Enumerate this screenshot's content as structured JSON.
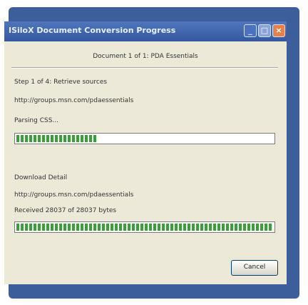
{
  "window": {
    "title": "ISiloX Document Conversion Progress",
    "buttons": {
      "minimize": "_",
      "maximize": "□",
      "close": "×"
    }
  },
  "document": {
    "header": "Document 1 of 1: PDA Essentials"
  },
  "step": {
    "label": "Step 1 of 4: Retrieve sources",
    "url": "http://groups.msn.com/pdaessentials",
    "status": "Parsing CSS...",
    "progress": 0.32
  },
  "download": {
    "label": "Download Detail",
    "url": "http://groups.msn.com/pdaessentials",
    "received": "Received 28037 of 28037 bytes",
    "progress": 1.0
  },
  "actions": {
    "cancel": "Cancel"
  }
}
